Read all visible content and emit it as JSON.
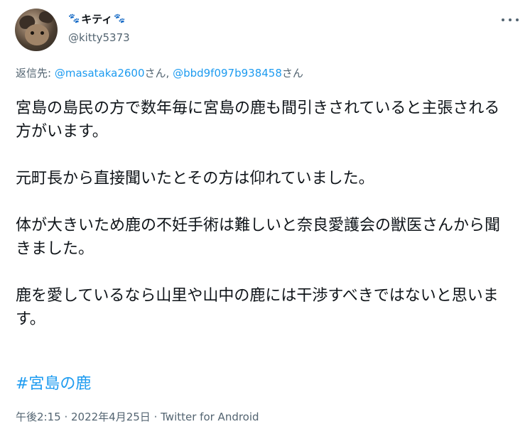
{
  "author": {
    "display_name": "キティ",
    "paw_emoji": "🐾",
    "handle": "@kitty5373",
    "avatar_icon": "cat-avatar"
  },
  "menu_icon": "more-icon",
  "reply": {
    "prefix": "返信先: ",
    "user1": "@masataka2600",
    "suffix1": "さん, ",
    "user2": "@bbd9f097b938458",
    "suffix2": "さん"
  },
  "tweet": {
    "paragraphs": [
      "宮島の島民の方で数年毎に宮島の鹿も間引きされていると主張される方がいます。",
      "元町長から直接聞いたとその方は仰れていました。",
      "体が大きいため鹿の不妊手術は難しいと奈良愛護会の獣医さんから聞きました。",
      "鹿を愛しているなら山里や山中の鹿には干渉すべきではないと思います。"
    ],
    "hashtag": "#宮島の鹿"
  },
  "meta": {
    "time": "午後2:15",
    "sep1": " · ",
    "date": "2022年4月25日",
    "sep2": " · ",
    "source": "Twitter for Android"
  },
  "colors": {
    "link": "#1d9bf0",
    "secondary": "#536471",
    "text": "#0f1419"
  }
}
